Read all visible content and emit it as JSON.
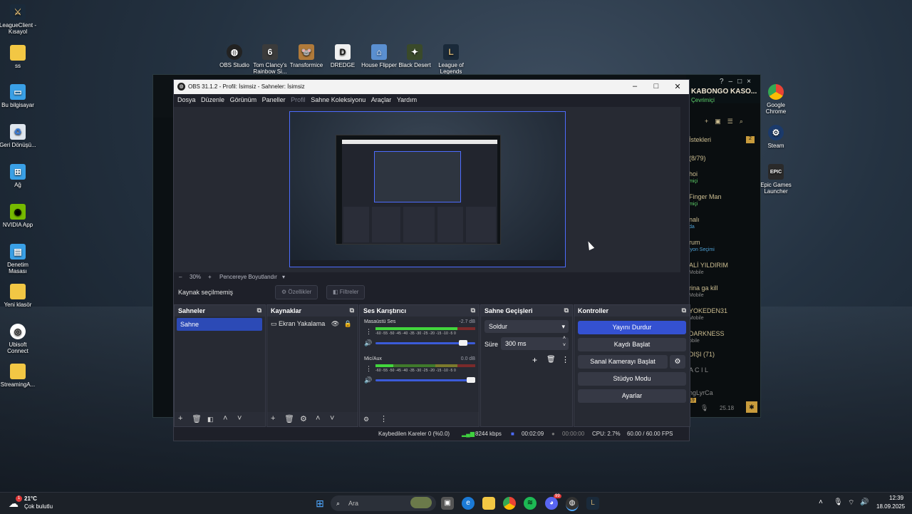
{
  "desktop": {
    "left_icons": [
      {
        "label": "LeagueClient - Kısayol",
        "icon": "league-icon"
      },
      {
        "label": "ss",
        "icon": "folder-icon"
      },
      {
        "label": "Bu bilgisayar",
        "icon": "computer-icon"
      },
      {
        "label": "Geri Dönüşü...",
        "icon": "recycle-bin-icon"
      },
      {
        "label": "Ağ",
        "icon": "network-icon"
      },
      {
        "label": "NVIDIA App",
        "icon": "nvidia-icon"
      },
      {
        "label": "Denetim Masası",
        "icon": "control-panel-icon"
      },
      {
        "label": "Yeni klasör",
        "icon": "folder-icon"
      },
      {
        "label": "Ubisoft Connect",
        "icon": "ubisoft-icon"
      },
      {
        "label": "StreamingA...",
        "icon": "folder-icon"
      }
    ],
    "top_icons": [
      {
        "label": "OBS Studio",
        "icon": "obs-icon"
      },
      {
        "label": "Tom Clancy's Rainbow Si...",
        "icon": "rainbow-six-icon"
      },
      {
        "label": "Transformice",
        "icon": "transformice-icon"
      },
      {
        "label": "DREDGE",
        "icon": "dredge-icon"
      },
      {
        "label": "House Flipper",
        "icon": "house-flipper-icon"
      },
      {
        "label": "Black Desert",
        "icon": "black-desert-icon"
      },
      {
        "label": "League of Legends",
        "icon": "league-icon"
      }
    ],
    "right_icons": [
      {
        "label": "Google Chrome",
        "icon": "chrome-icon"
      },
      {
        "label": "Steam",
        "icon": "steam-icon"
      },
      {
        "label": "Epic Games Launcher",
        "icon": "epic-icon"
      }
    ]
  },
  "league_client": {
    "username": "KABONGO KASO...",
    "status": "Çevrimiçi",
    "section": "İstekleri",
    "section_count": "2",
    "count_line": "(8/79)",
    "friends": [
      {
        "name": "hoi",
        "sub": "miçi"
      },
      {
        "name": "Finger Man",
        "sub": "miçi"
      },
      {
        "name": "nalı",
        "sub": "da"
      },
      {
        "name": "rum",
        "sub": "iyon Seçimi"
      },
      {
        "name": "ALİ YILDIRIM",
        "sub": "Mobile"
      },
      {
        "name": "rina ga kill",
        "sub": "Mobile"
      },
      {
        "name": "YOKEDEN31",
        "sub": "Mobile"
      },
      {
        "name": "DARKNESS",
        "sub": "obile"
      }
    ],
    "offline_label": "DIŞI (71)",
    "extra1": "A C I L",
    "extra2": "ngLyrCa",
    "clock": "25.18",
    "badge": "19"
  },
  "obs": {
    "title": "OBS 31.1.2 - Profil: İsimsiz - Sahneler: İsimsiz",
    "menu": [
      "Dosya",
      "Düzenle",
      "Görünüm",
      "Paneller",
      "Profil",
      "Sahne Koleksiyonu",
      "Araçlar",
      "Yardım"
    ],
    "zoom": "30%",
    "fit_label": "Pencereye Boyutlandır",
    "no_source": "Kaynak seçilmemiş",
    "properties": "Özellikler",
    "filters": "Filtreler",
    "scenes": {
      "title": "Sahneler",
      "items": [
        "Sahne"
      ]
    },
    "sources": {
      "title": "Kaynaklar",
      "items": [
        "Ekran Yakalama"
      ]
    },
    "mixer": {
      "title": "Ses Karıştırıcı",
      "ticks": "-60 -55 -50 -45 -40 -35 -30 -25 -20 -15 -10 -5 0",
      "channels": [
        {
          "name": "Masaüstü Ses",
          "db": "-2.7 dB",
          "level": 0.82,
          "volume": 0.92
        },
        {
          "name": "Mic/Aux",
          "db": "0.0 dB",
          "level": 0.18,
          "volume": 1.0
        }
      ]
    },
    "transitions": {
      "title": "Sahne Geçişleri",
      "type": "Soldur",
      "duration_label": "Süre",
      "duration": "300 ms"
    },
    "controls": {
      "title": "Kontroller",
      "buttons": [
        "Yayını Durdur",
        "Kaydı Başlat",
        "Sanal Kamerayı Başlat",
        "Stüdyo Modu",
        "Ayarlar"
      ]
    },
    "status": {
      "dropped": "Kaybedilen Kareler 0 (%0.0)",
      "bitrate": "8244 kbps",
      "stream_time": "00:02:09",
      "rec_time": "00:00:00",
      "cpu": "CPU: 2.7%",
      "fps": "60.00 / 60.00 FPS"
    }
  },
  "taskbar": {
    "weather_temp": "21°C",
    "weather_desc": "Çok bulutlu",
    "weather_badge": "1",
    "search_placeholder": "Ara",
    "time": "12:39",
    "date": "18.09.2025",
    "discord_badge": "99"
  }
}
